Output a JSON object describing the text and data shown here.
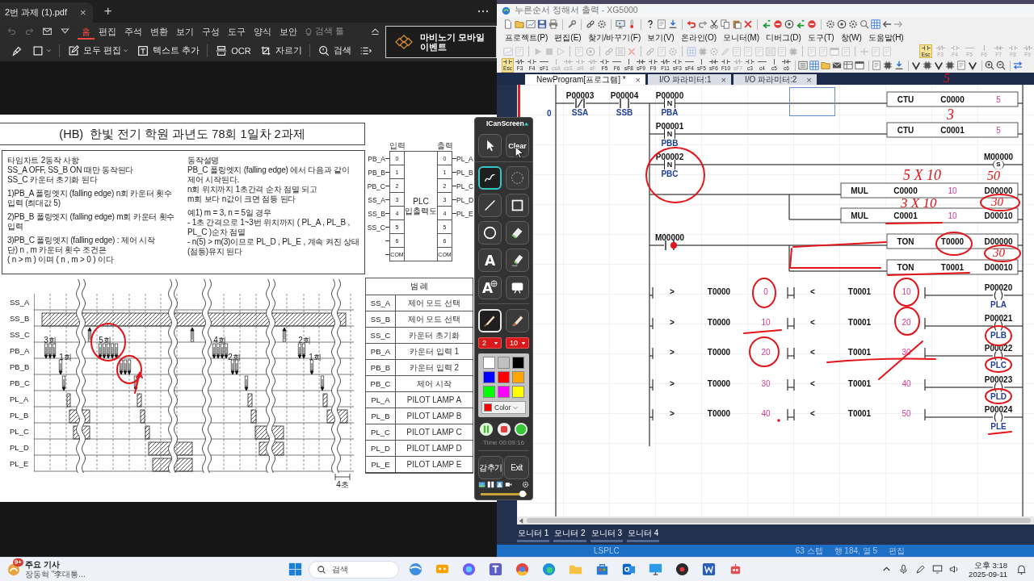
{
  "pdf_viewer": {
    "tab": {
      "title": "2번 과제 (1).pdf",
      "close": "×"
    },
    "new_tab": "+",
    "menu": [
      {
        "label": "홈",
        "selected": true
      },
      {
        "label": "편집",
        "selected": false
      },
      {
        "label": "주석",
        "selected": false
      },
      {
        "label": "변환",
        "selected": false
      },
      {
        "label": "보기",
        "selected": false
      },
      {
        "label": "구성",
        "selected": false
      },
      {
        "label": "도구",
        "selected": false
      },
      {
        "label": "양식",
        "selected": false
      },
      {
        "label": "보안",
        "selected": false
      }
    ],
    "search_tool": "검색 툴",
    "tools": [
      {
        "kind": "highlighter",
        "dropdown": false
      },
      {
        "kind": "rectangle",
        "dropdown": true
      },
      {
        "kind": "edit",
        "label": "모두 편집",
        "dropdown": true
      },
      {
        "kind": "text",
        "label": "텍스트 추가",
        "dropdown": false
      },
      {
        "kind": "ocr",
        "label": "OCR",
        "dropdown": false
      },
      {
        "kind": "crop",
        "label": "자르기",
        "dropdown": false
      },
      {
        "kind": "search",
        "label": "검색",
        "dropdown": false
      },
      {
        "kind": "list",
        "dropdown": false
      }
    ],
    "ad": {
      "text": "마비노기 모바일 이벤트"
    },
    "document": {
      "title": "(HB)  한빛 전기 학원 과년도 78회 1일차 2과제",
      "spec_left": [
        [
          "타임차트 2동작 사항",
          "SS_A OFF, SS_B ON 때만 동작된다",
          "SS_C 카운터 초기화 된다"
        ],
        [
          "1)PB_A 폴링엣지 (falling edge) n회 카운터 횟수 입력 (최대값 5)"
        ],
        [
          "2)PB_B 폴링엣지 (falling edge) m회 카운터 횟수 입력"
        ],
        [
          "3)PB_C 폴링엣지 (falling edge) : 제어 시작",
          "단) n , m 카운터 횟수 조건은",
          "( n > m ) 이며 ( n , m > 0 ) 이다"
        ]
      ],
      "spec_right": [
        [
          "동작설명",
          "PB_C 폴링엣지 (falling edge) 에서 다음과 같이 제어 시작된다.",
          "n회 위치까지 1초간격 순차 점멸 되고",
          "m회 보다 n값이 크면 점등 된다"
        ],
        [
          "예1)  m = 3, n = 5일 경우",
          "- 1초 간격으로 1~3번 위치까지 ( PL_A , PL_B , PL_C )순차 점멸",
          "- n(5) > m(3)이므로 PL_D , PL_E , 계속 켜진 상태(점등)유지 된다"
        ]
      ],
      "plc": {
        "input_title": "입력",
        "output_title": "출력",
        "name": "PLC",
        "subtitle": "입출력도",
        "inputs": [
          {
            "signal": "PB_A",
            "terminal": "0"
          },
          {
            "signal": "PB_B",
            "terminal": "1"
          },
          {
            "signal": "PB_C",
            "terminal": "2"
          },
          {
            "signal": "SS_A",
            "terminal": "3"
          },
          {
            "signal": "SS_B",
            "terminal": "4"
          },
          {
            "signal": "SS_C",
            "terminal": "5"
          },
          {
            "terminal": "6"
          },
          {
            "terminal": "COM"
          }
        ],
        "outputs": [
          {
            "signal": "PL_A",
            "terminal": "0"
          },
          {
            "signal": "PL_B",
            "terminal": "1"
          },
          {
            "signal": "PL_C",
            "terminal": "2"
          },
          {
            "signal": "PL_D",
            "terminal": "3"
          },
          {
            "signal": "PL_E",
            "terminal": "4"
          },
          {
            "terminal": "5"
          },
          {
            "terminal": "6"
          },
          {
            "terminal": "COM"
          }
        ]
      },
      "timing": {
        "signals": [
          "SS_A",
          "SS_B",
          "SS_C",
          "PB_A",
          "PB_B",
          "PB_C",
          "PL_A",
          "PL_B",
          "PL_C",
          "PL_D",
          "PL_E"
        ],
        "counts": [
          "3회",
          "1회",
          "5회",
          "4회",
          "2회",
          "2회",
          "1회"
        ],
        "scale": "4초"
      },
      "legend": {
        "title": "범 례",
        "rows": [
          {
            "signal": "SS_A",
            "description": "제어 모드 선택"
          },
          {
            "signal": "SS_B",
            "description": "제어 모드 선택"
          },
          {
            "signal": "SS_C",
            "description": "카운터 초기화"
          },
          {
            "signal": "PB_A",
            "description": "카운터 입력 1"
          },
          {
            "signal": "PB_B",
            "description": "카운터 입력 2"
          },
          {
            "signal": "PB_C",
            "description": "제어 시작"
          },
          {
            "signal": "PL_A",
            "description": "PILOT LAMP A"
          },
          {
            "signal": "PL_B",
            "description": "PILOT LAMP B"
          },
          {
            "signal": "PL_C",
            "description": "PILOT LAMP C"
          },
          {
            "signal": "PL_D",
            "description": "PILOT LAMP D"
          },
          {
            "signal": "PL_E",
            "description": "PILOT LAMP E"
          }
        ]
      }
    }
  },
  "icanscreen": {
    "title": "ICanScreen",
    "tools": [
      {
        "kind": "pointer",
        "selected": false
      },
      {
        "kind": "clear",
        "label": "Clear",
        "selected": false
      },
      {
        "kind": "curve",
        "selected": true
      },
      {
        "kind": "lasso",
        "selected": false
      },
      {
        "kind": "line",
        "selected": false
      },
      {
        "kind": "rectangle",
        "selected": false
      },
      {
        "kind": "circle",
        "selected": false
      },
      {
        "kind": "eraser",
        "selected": false
      },
      {
        "kind": "text",
        "label": "A",
        "selected": false
      },
      {
        "kind": "highlighter",
        "selected": false
      },
      {
        "kind": "web_text",
        "label": "A",
        "selected": false
      },
      {
        "kind": "whiteboard",
        "selected": false
      }
    ],
    "pens": [
      {
        "kind": "pen",
        "selected": true
      },
      {
        "kind": "marker",
        "selected": false
      }
    ],
    "dropdowns": [
      "2",
      "10"
    ],
    "swatches": [
      {
        "color": "#ffffff"
      },
      {
        "color": "#c0c0c0"
      },
      {
        "color": "#000000"
      },
      {
        "color": "#0000ff"
      },
      {
        "color": "#ff0000"
      },
      {
        "color": "#ffa500"
      },
      {
        "color": "#00ff00"
      },
      {
        "color": "#ff00ff"
      },
      {
        "color": "#ffff00"
      }
    ],
    "current_color": {
      "color": "#ff0000",
      "label": "Color"
    },
    "time": "Time 00:09:16",
    "hide": "감추기",
    "exit": "Exit",
    "slider": {
      "level": 0.97
    }
  },
  "xg5000": {
    "title": "누른순서 정해서 출력 - XG5000",
    "menu": [
      "프로젝트(P)",
      "편집(E)",
      "찾기/바꾸기(F)",
      "보기(V)",
      "온라인(O)",
      "모니터(M)",
      "디버그(D)",
      "도구(T)",
      "창(W)",
      "도움말(H)"
    ],
    "mode_keys": [
      {
        "key": "Esc",
        "selected": true,
        "disabled": false
      },
      {
        "key": "F3",
        "selected": false,
        "disabled": true
      },
      {
        "key": "F4",
        "selected": false,
        "disabled": true
      },
      {
        "key": "F5",
        "selected": false,
        "disabled": true
      },
      {
        "key": "F6",
        "selected": false,
        "disabled": true
      },
      {
        "key": "F7",
        "selected": false,
        "disabled": true
      },
      {
        "key": "F8",
        "selected": false,
        "disabled": true
      },
      {
        "key": "F9",
        "selected": false,
        "disabled": true
      }
    ],
    "edit_keys": [
      {
        "key": "Esc",
        "selected": true,
        "disabled": false
      },
      {
        "key": "F3",
        "selected": false,
        "disabled": false
      },
      {
        "key": "F4",
        "selected": false,
        "disabled": false
      },
      {
        "key": "sF1",
        "selected": false,
        "disabled": false
      },
      {
        "key": "csA",
        "selected": false,
        "disabled": true
      },
      {
        "key": "csS",
        "selected": false,
        "disabled": true
      },
      {
        "key": "aR",
        "selected": false,
        "disabled": true
      },
      {
        "key": "aF",
        "selected": false,
        "disabled": true
      },
      {
        "key": "F5",
        "selected": false,
        "disabled": false
      },
      {
        "key": "F6",
        "selected": false,
        "disabled": false
      },
      {
        "key": "sF8",
        "selected": false,
        "disabled": false
      },
      {
        "key": "sF9",
        "selected": false,
        "disabled": false
      },
      {
        "key": "F9",
        "selected": false,
        "disabled": false
      },
      {
        "key": "F11",
        "selected": false,
        "disabled": false
      },
      {
        "key": "sF3",
        "selected": false,
        "disabled": false
      },
      {
        "key": "sF4",
        "selected": false,
        "disabled": false
      },
      {
        "key": "sF5",
        "selected": false,
        "disabled": false
      },
      {
        "key": "sF6",
        "selected": false,
        "disabled": false
      },
      {
        "key": "F10",
        "selected": false,
        "disabled": false
      },
      {
        "key": "sF7",
        "selected": false,
        "disabled": true
      },
      {
        "key": "c3",
        "selected": false,
        "disabled": false
      },
      {
        "key": "c4",
        "selected": false,
        "disabled": false
      },
      {
        "key": "c5",
        "selected": false,
        "disabled": false
      },
      {
        "key": "c6",
        "selected": false,
        "disabled": false
      }
    ],
    "tabs": [
      {
        "label": "NewProgram[프로그램] *",
        "close": "×",
        "selected": true
      },
      {
        "label": "I/O 파라미터:1",
        "close": "×",
        "selected": false
      },
      {
        "label": "I/O 파라미터:2",
        "close": "×",
        "selected": false
      }
    ],
    "ladder": {
      "step": "0",
      "rungs": [
        {
          "kind": "counter",
          "parallel": false,
          "contacts": [
            {
              "kind": "nc",
              "address": "P00003",
              "comment": "SSA"
            },
            {
              "kind": "no",
              "address": "P00004",
              "comment": "SSB"
            },
            {
              "kind": "falling",
              "symbol": "N",
              "address": "P00000",
              "comment": "PBA"
            }
          ],
          "op": "CTU",
          "operands": [
            {
              "kind": "device",
              "text": "C0000"
            },
            {
              "kind": "constant",
              "text": "5"
            }
          ]
        },
        {
          "kind": "counter",
          "parallel": false,
          "contacts": [
            {
              "kind": "falling",
              "symbol": "N",
              "address": "P00001",
              "comment": "PBB"
            }
          ],
          "op": "CTU",
          "operands": [
            {
              "kind": "device",
              "text": "C0001"
            },
            {
              "kind": "constant",
              "text": "5"
            }
          ]
        },
        {
          "kind": "set",
          "parallel": false,
          "contacts": [
            {
              "kind": "falling",
              "symbol": "N",
              "address": "P00002",
              "comment": "PBC"
            }
          ],
          "coil": {
            "kind": "set",
            "symbol": "S",
            "address": "M00000"
          }
        },
        {
          "kind": "math",
          "parallel": false,
          "op": "MUL",
          "operands": [
            {
              "kind": "device",
              "text": "C0000"
            },
            {
              "kind": "constant",
              "text": "10"
            },
            {
              "kind": "device",
              "text": "D00000"
            }
          ]
        },
        {
          "kind": "math",
          "parallel": true,
          "op": "MUL",
          "operands": [
            {
              "kind": "device",
              "text": "C0001"
            },
            {
              "kind": "constant",
              "text": "10"
            },
            {
              "kind": "device",
              "text": "D00010"
            }
          ]
        },
        {
          "kind": "timer",
          "parallel": false,
          "contacts": [
            {
              "kind": "no",
              "address": "M00000"
            }
          ],
          "op": "TON",
          "operands": [
            {
              "kind": "device",
              "text": "T0000"
            },
            {
              "kind": "device",
              "text": "D00000"
            }
          ]
        },
        {
          "kind": "timer",
          "parallel": true,
          "op": "TON",
          "operands": [
            {
              "kind": "device",
              "text": "T0001"
            },
            {
              "kind": "device",
              "text": "D00010"
            }
          ]
        },
        {
          "kind": "compare",
          "parallel": false,
          "compares": [
            {
              "op": ">",
              "device": "T0000",
              "value": "0"
            },
            {
              "op": "<",
              "device": "T0001",
              "value": "10"
            }
          ],
          "coil": {
            "kind": "out",
            "address": "P00020",
            "comment": "PLA"
          }
        },
        {
          "kind": "compare",
          "parallel": false,
          "compares": [
            {
              "op": ">",
              "device": "T0000",
              "value": "10"
            },
            {
              "op": "<",
              "device": "T0001",
              "value": "20"
            }
          ],
          "coil": {
            "kind": "out",
            "address": "P00021",
            "comment": "PLB"
          }
        },
        {
          "kind": "compare",
          "parallel": false,
          "compares": [
            {
              "op": ">",
              "device": "T0000",
              "value": "20"
            },
            {
              "op": "<",
              "device": "T0001",
              "value": "30"
            }
          ],
          "coil": {
            "kind": "out",
            "address": "P00022",
            "comment": "PLC"
          }
        },
        {
          "kind": "compare",
          "parallel": false,
          "compares": [
            {
              "op": ">",
              "device": "T0000",
              "value": "30"
            },
            {
              "op": "<",
              "device": "T0001",
              "value": "40"
            }
          ],
          "coil": {
            "kind": "out",
            "address": "P00023",
            "comment": "PLD"
          }
        },
        {
          "kind": "compare",
          "parallel": false,
          "compares": [
            {
              "op": ">",
              "device": "T0000",
              "value": "40"
            },
            {
              "op": "<",
              "device": "T0001",
              "value": "50"
            }
          ],
          "coil": {
            "kind": "out",
            "address": "P00024",
            "comment": "PLE"
          }
        }
      ]
    },
    "monitor_tabs": [
      "모니터 1",
      "모니터 2",
      "모니터 3",
      "모니터 4"
    ],
    "status": [
      "LSPLC",
      "63 스텝",
      "행 184, 열 5",
      "편집"
    ]
  },
  "taskbar": {
    "news": {
      "badge": "9+",
      "title": "주요 기사",
      "headline": "장동혁 \"李대통..."
    },
    "search": {
      "placeholder": "검색"
    },
    "clock": {
      "time": "오후 3:18",
      "date": "2025-09-11"
    }
  },
  "handwritten_notes": [
    "5",
    "3",
    "5 X 10",
    "50",
    "3 X 10",
    "30",
    "30"
  ]
}
